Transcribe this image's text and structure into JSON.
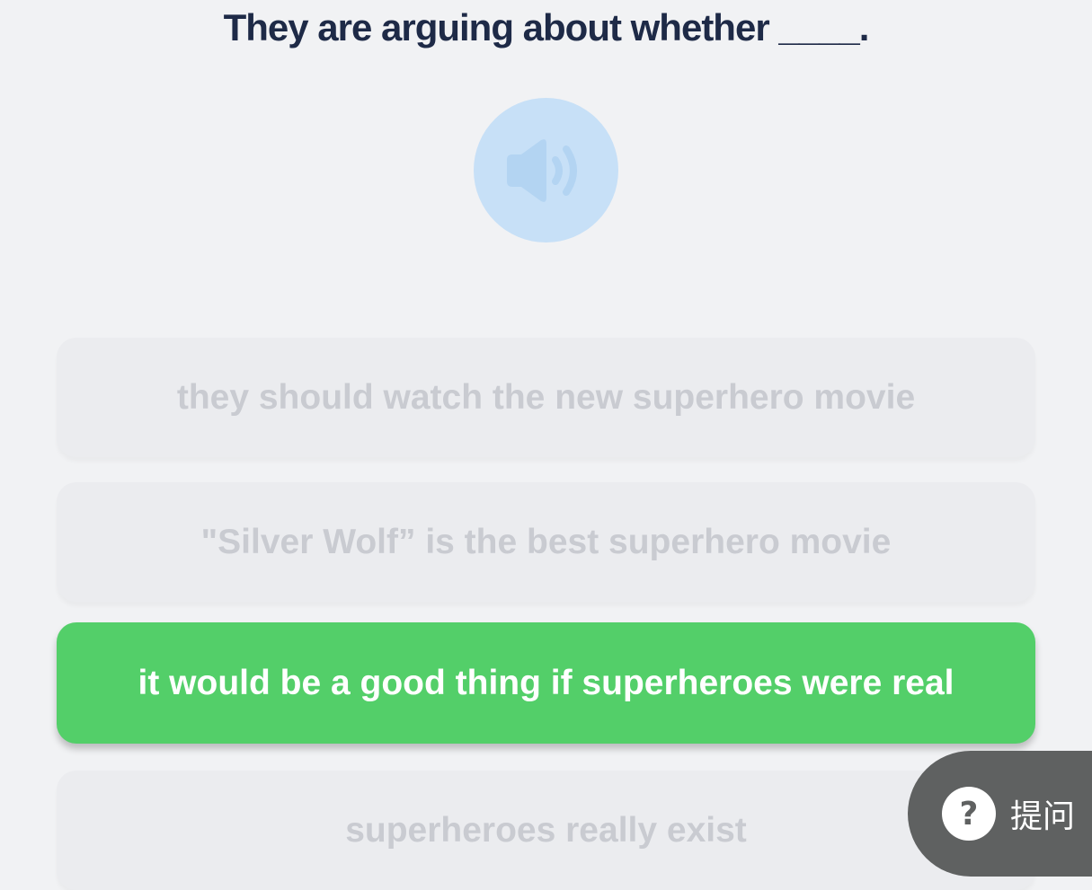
{
  "question": {
    "text": "They are arguing about whether ____."
  },
  "audio": {
    "icon": "speaker-icon",
    "color": "#c7e0f7"
  },
  "options": [
    {
      "label": "they should watch the new superhero movie",
      "selected": false
    },
    {
      "label": "\"Silver Wolf” is the best superhero movie",
      "selected": false
    },
    {
      "label": "it would be a good thing if superheroes were real",
      "selected": true
    },
    {
      "label": "superheroes really exist",
      "selected": false
    }
  ],
  "help": {
    "icon_glyph": "?",
    "label": "提问"
  },
  "colors": {
    "selected": "#53cf69",
    "title": "#1e2a47",
    "unselected_text": "#c9cbd1"
  }
}
